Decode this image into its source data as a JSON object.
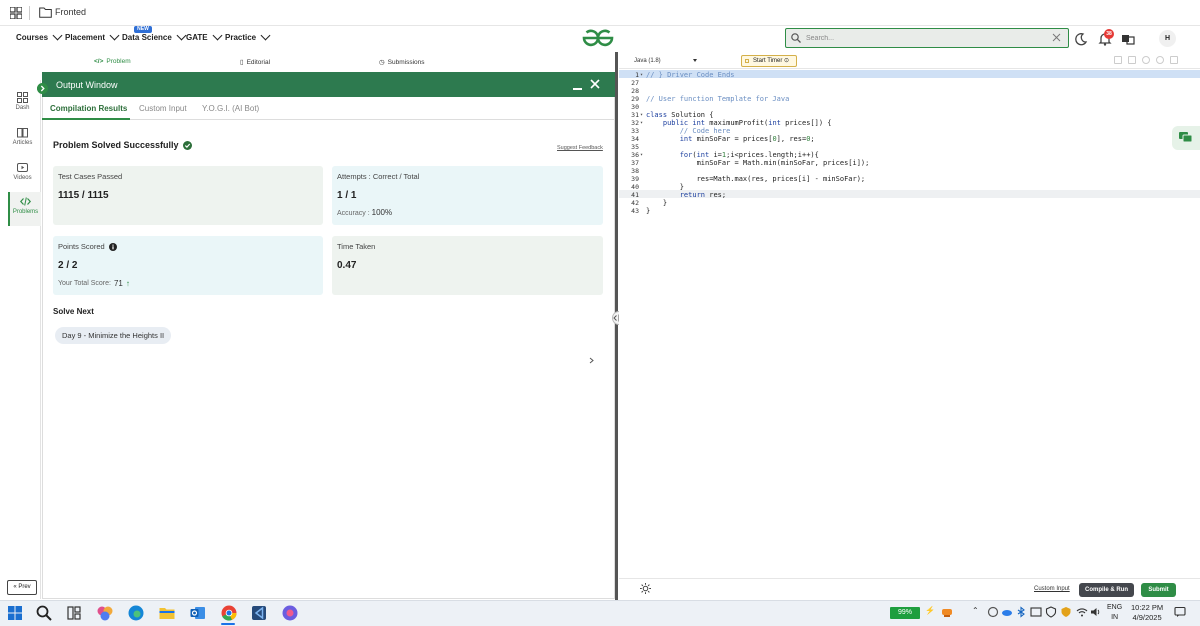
{
  "window": {
    "folder_title": "Fronted"
  },
  "nav": {
    "items": [
      "Courses",
      "Placement",
      "Data Science",
      "GATE",
      "Practice"
    ],
    "new_badge": "NEW",
    "search_placeholder": "Search...",
    "notification_count": "38",
    "avatar_initial": "H"
  },
  "sidebar": {
    "items": [
      "Dash",
      "Articles",
      "Videos",
      "Problems"
    ],
    "prev_label": "« Prev"
  },
  "problem_tabs": [
    "Problem",
    "Editorial",
    "Submissions"
  ],
  "output": {
    "title": "Output Window",
    "tabs": [
      "Compilation Results",
      "Custom Input",
      "Y.O.G.I. (AI Bot)"
    ],
    "status": "Problem Solved Successfully",
    "feedback": "Suggest Feedback",
    "cards": {
      "tests_label": "Test Cases Passed",
      "tests_value": "1115 / 1115",
      "attempts_label": "Attempts : Correct / Total",
      "attempts_value": "1 / 1",
      "accuracy_label": "Accuracy :",
      "accuracy_value": "100%",
      "points_label": "Points Scored",
      "points_value": "2 / 2",
      "total_label": "Your Total Score:",
      "total_value": "71",
      "time_label": "Time Taken",
      "time_value": "0.47"
    },
    "solve_next": "Solve Next",
    "next_problem": "Day 9 - Minimize the Heights II"
  },
  "editor": {
    "language": "Java (1.8)",
    "timer": "Start Timer",
    "custom_input": "Custom Input",
    "compile_run": "Compile & Run",
    "submit": "Submit",
    "lines": [
      {
        "n": "1",
        "fold": true,
        "text": "// } Driver Code Ends"
      },
      {
        "n": "27",
        "fold": false,
        "text": ""
      },
      {
        "n": "28",
        "fold": false,
        "text": ""
      },
      {
        "n": "29",
        "fold": false,
        "text": "// User function Template for Java"
      },
      {
        "n": "30",
        "fold": false,
        "text": ""
      },
      {
        "n": "31",
        "fold": true,
        "text": "class Solution {"
      },
      {
        "n": "32",
        "fold": true,
        "text": "    public int maximumProfit(int prices[]) {"
      },
      {
        "n": "33",
        "fold": false,
        "text": "        // Code here"
      },
      {
        "n": "34",
        "fold": false,
        "text": "        int minSoFar = prices[0], res=0;"
      },
      {
        "n": "35",
        "fold": false,
        "text": ""
      },
      {
        "n": "36",
        "fold": true,
        "text": "        for(int i=1;i<prices.length;i++){"
      },
      {
        "n": "37",
        "fold": false,
        "text": "            minSoFar = Math.min(minSoFar, prices[i]);"
      },
      {
        "n": "38",
        "fold": false,
        "text": ""
      },
      {
        "n": "39",
        "fold": false,
        "text": "            res=Math.max(res, prices[i] - minSoFar);"
      },
      {
        "n": "40",
        "fold": false,
        "text": "        }"
      },
      {
        "n": "41",
        "fold": false,
        "text": "        return res;"
      },
      {
        "n": "42",
        "fold": false,
        "text": "    }"
      },
      {
        "n": "43",
        "fold": false,
        "text": "}"
      }
    ]
  },
  "taskbar": {
    "battery": "99%",
    "lang_line1": "ENG",
    "lang_line2": "IN",
    "time": "10:22 PM",
    "date": "4/9/2025"
  },
  "colors": {
    "brand_green": "#2f8d46",
    "output_header": "#2d7a4f"
  }
}
